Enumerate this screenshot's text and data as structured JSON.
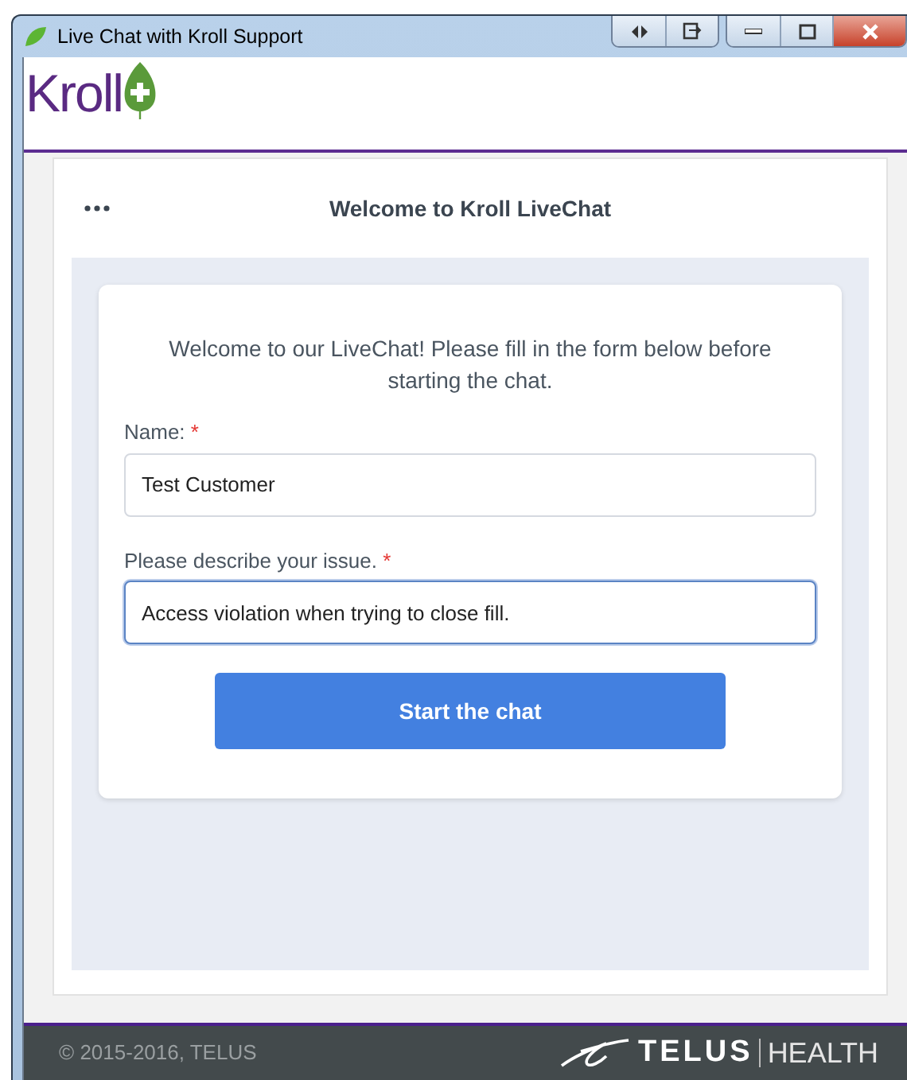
{
  "window": {
    "title": "Live Chat with Kroll Support"
  },
  "header": {
    "logo_text": "Kroll"
  },
  "chat": {
    "title": "Welcome to Kroll LiveChat",
    "intro": "Welcome to our LiveChat! Please fill in the form below before starting the chat.",
    "fields": [
      {
        "label": "Name:",
        "required_mark": "*",
        "value": "Test Customer",
        "focused": false
      },
      {
        "label": "Please describe your issue.",
        "required_mark": "*",
        "value": "Access violation when trying to close fill.",
        "focused": true
      }
    ],
    "submit": "Start the chat"
  },
  "footer": {
    "copyright": "© 2015-2016, TELUS",
    "brand": "TELUS",
    "brand_suffix": "HEALTH"
  }
}
